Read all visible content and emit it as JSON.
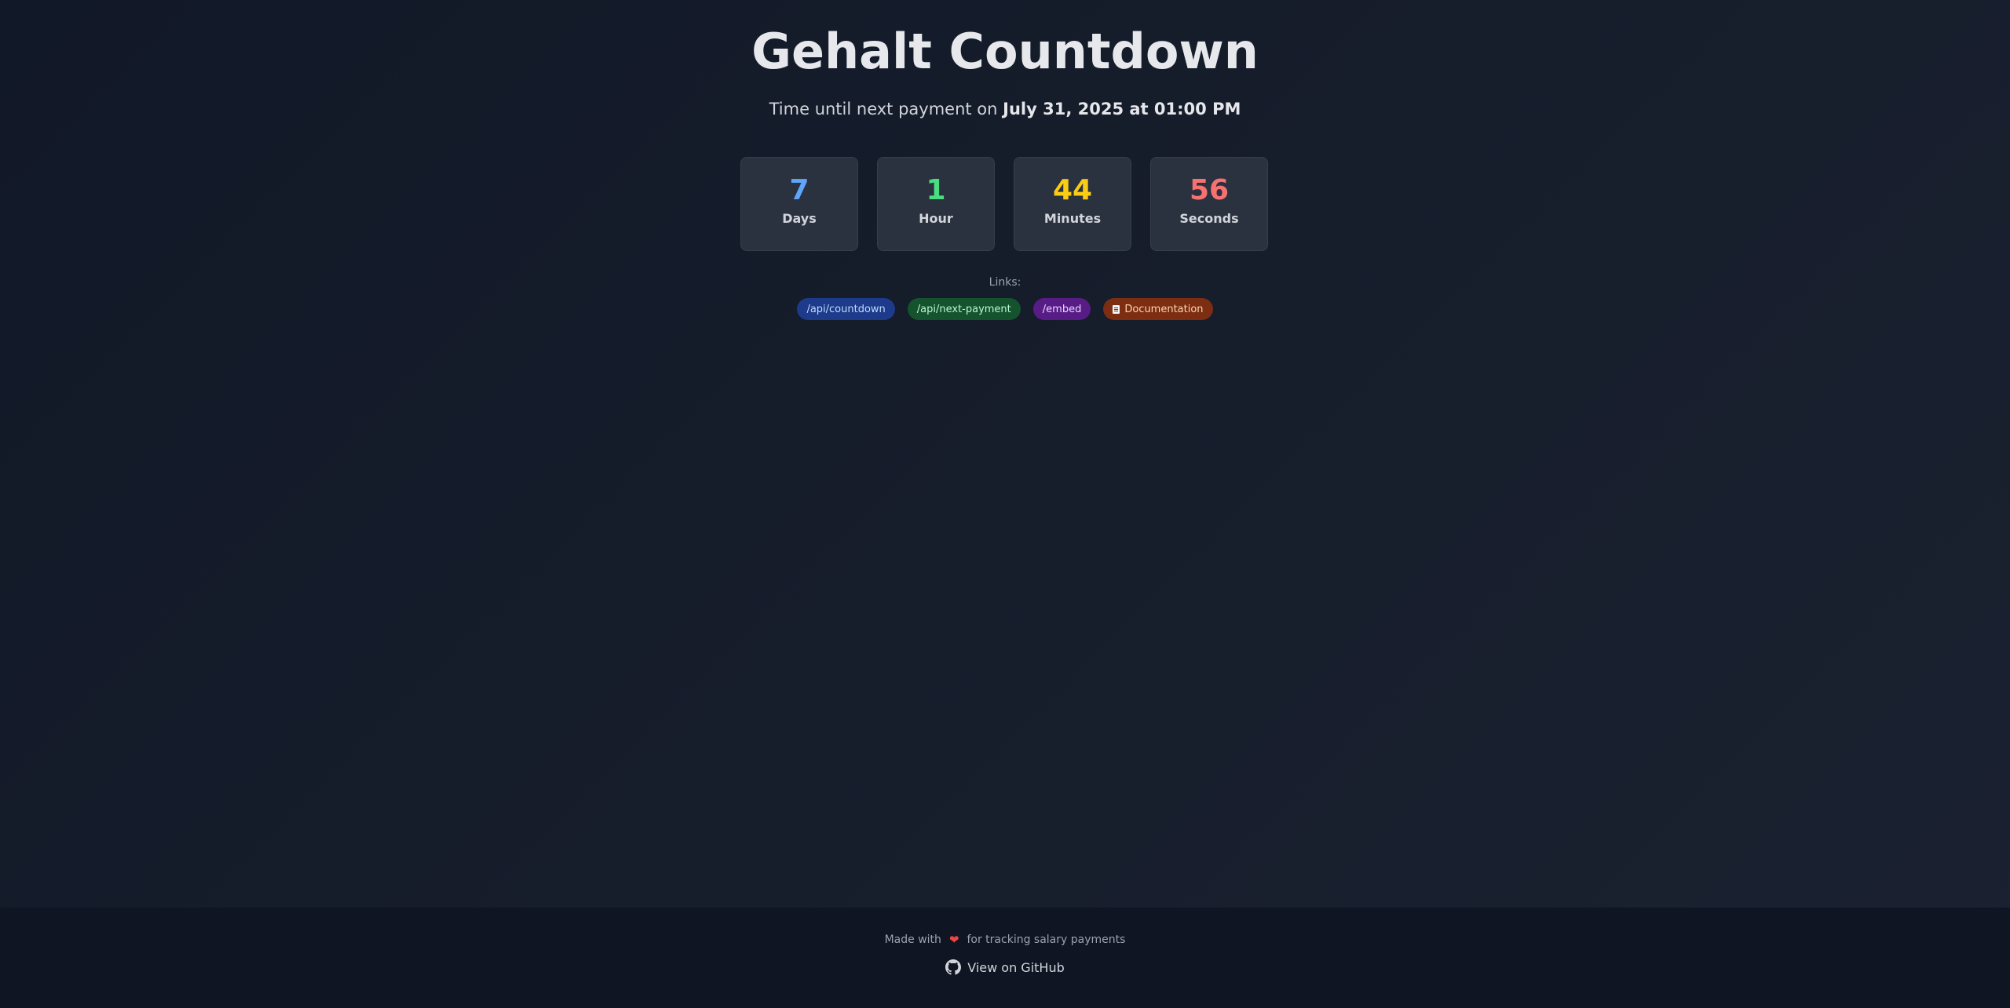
{
  "header": {
    "title": "Gehalt Countdown",
    "subtitle_prefix": "Time until next payment on",
    "payment_date": "July 31, 2025 at 01:00 PM"
  },
  "countdown": [
    {
      "value": "7",
      "unit": "Days",
      "color": "#60a5fa"
    },
    {
      "value": "1",
      "unit": "Hour",
      "color": "#4ade80"
    },
    {
      "value": "44",
      "unit": "Minutes",
      "color": "#facc15"
    },
    {
      "value": "56",
      "unit": "Seconds",
      "color": "#f87171"
    }
  ],
  "links": {
    "label": "Links:",
    "items": [
      {
        "label": "/api/countdown"
      },
      {
        "label": "/api/next-payment"
      },
      {
        "label": "/embed"
      },
      {
        "label": "Documentation",
        "icon": "document-icon"
      }
    ]
  },
  "footer": {
    "made_with": "Made with",
    "made_for": "for tracking salary payments",
    "heart_icon": "heart-icon",
    "github_label": "View on GitHub",
    "github_icon": "github-icon"
  }
}
